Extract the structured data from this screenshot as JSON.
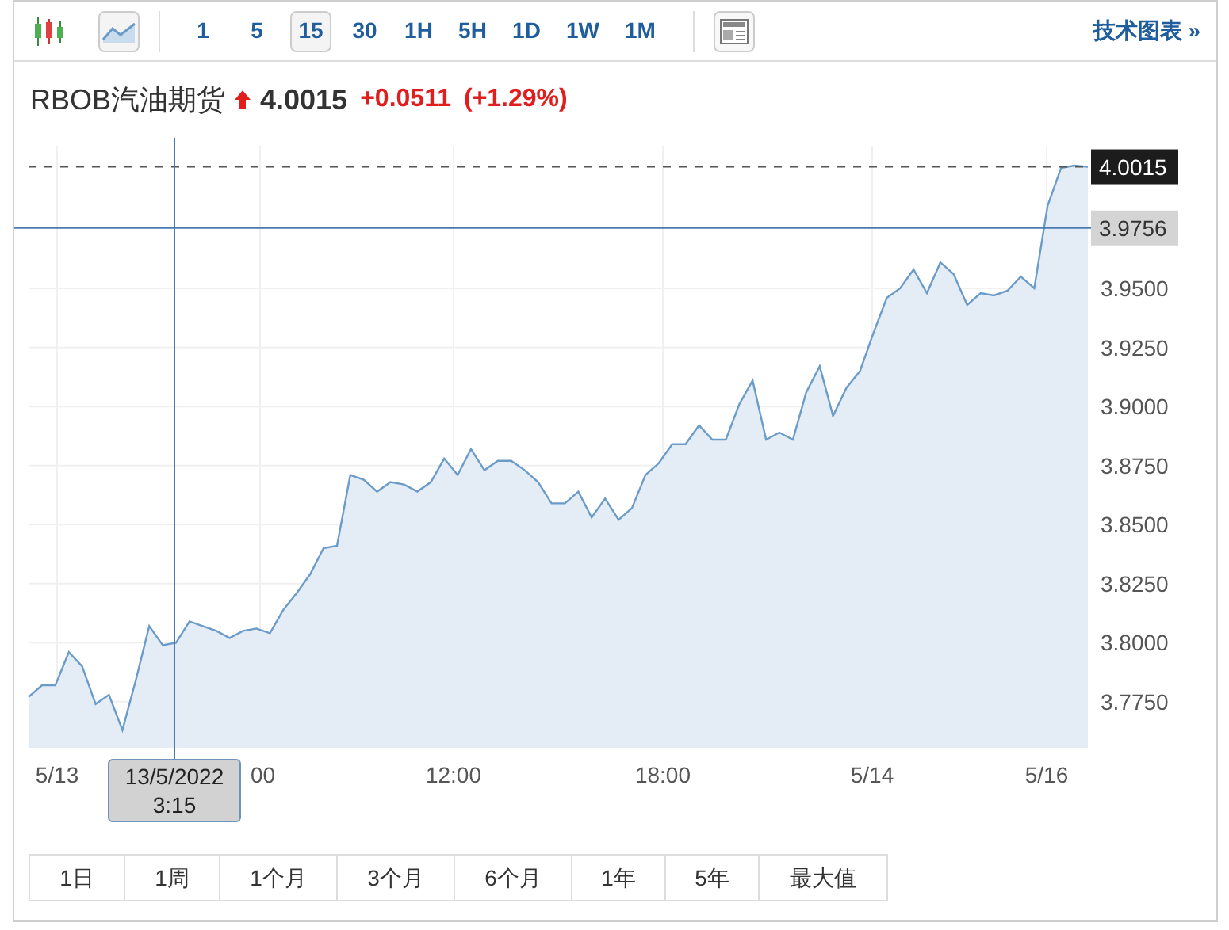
{
  "toolbar": {
    "chart_types": [
      {
        "kind": "candlestick",
        "selected": false
      },
      {
        "kind": "line",
        "selected": true
      }
    ],
    "intervals": [
      {
        "label": "1",
        "selected": false
      },
      {
        "label": "5",
        "selected": false
      },
      {
        "label": "15",
        "selected": true
      },
      {
        "label": "30",
        "selected": false
      },
      {
        "label": "1H",
        "selected": false
      },
      {
        "label": "5H",
        "selected": false
      },
      {
        "label": "1D",
        "selected": false
      },
      {
        "label": "1W",
        "selected": false
      },
      {
        "label": "1M",
        "selected": false
      }
    ],
    "link": "技术图表 »"
  },
  "quote": {
    "name": "RBOB汽油期货",
    "rising": true,
    "price": "4.0015",
    "change": "+0.0511",
    "change_percent": "(+1.29%)"
  },
  "chart": {
    "x_axis_labels": [
      "5/13",
      "00",
      "12:00",
      "18:00",
      "5/14",
      "5/16"
    ],
    "crosshair_date": "13/5/2022",
    "crosshair_time": "3:15",
    "chart_data": {
      "type": "area",
      "grid": true,
      "ylim": [
        3.7555,
        4.0104
      ],
      "series": [
        {
          "color": "#6b9bc9",
          "values": [
            3.777,
            3.782,
            3.782,
            3.796,
            3.79,
            3.774,
            3.778,
            3.763,
            3.784,
            3.807,
            3.799,
            3.8,
            3.809,
            3.807,
            3.805,
            3.802,
            3.805,
            3.806,
            3.804,
            3.814,
            3.821,
            3.829,
            3.84,
            3.841,
            3.871,
            3.869,
            3.864,
            3.868,
            3.867,
            3.864,
            3.868,
            3.878,
            3.871,
            3.882,
            3.873,
            3.877,
            3.877,
            3.873,
            3.868,
            3.859,
            3.859,
            3.864,
            3.853,
            3.861,
            3.852,
            3.857,
            3.871,
            3.876,
            3.884,
            3.884,
            3.892,
            3.886,
            3.886,
            3.901,
            3.911,
            3.886,
            3.889,
            3.886,
            3.906,
            3.917,
            3.896,
            3.908,
            3.915,
            3.931,
            3.946,
            3.95,
            3.958,
            3.948,
            3.961,
            3.956,
            3.943,
            3.948,
            3.947,
            3.949,
            3.955,
            3.95,
            3.985,
            4.001,
            4.002,
            4.0015
          ]
        }
      ],
      "yticks": [
        {
          "value": 3.775,
          "label": "3.7750"
        },
        {
          "value": 3.8,
          "label": "3.8000"
        },
        {
          "value": 3.825,
          "label": "3.8250"
        },
        {
          "value": 3.85,
          "label": "3.8500"
        },
        {
          "value": 3.875,
          "label": "3.8750"
        },
        {
          "value": 3.9,
          "label": "3.9000"
        },
        {
          "value": 3.925,
          "label": "3.9250"
        },
        {
          "value": 3.95,
          "label": "3.9500"
        }
      ],
      "ref_lines": [
        {
          "axis": "y",
          "value": 4.0015,
          "label": "4.0015"
        },
        {
          "axis": "y",
          "value": 3.9756,
          "label": "3.9756"
        }
      ]
    }
  },
  "ranges": [
    "1日",
    "1周",
    "1个月",
    "3个月",
    "6个月",
    "1年",
    "5年",
    "最大值"
  ]
}
